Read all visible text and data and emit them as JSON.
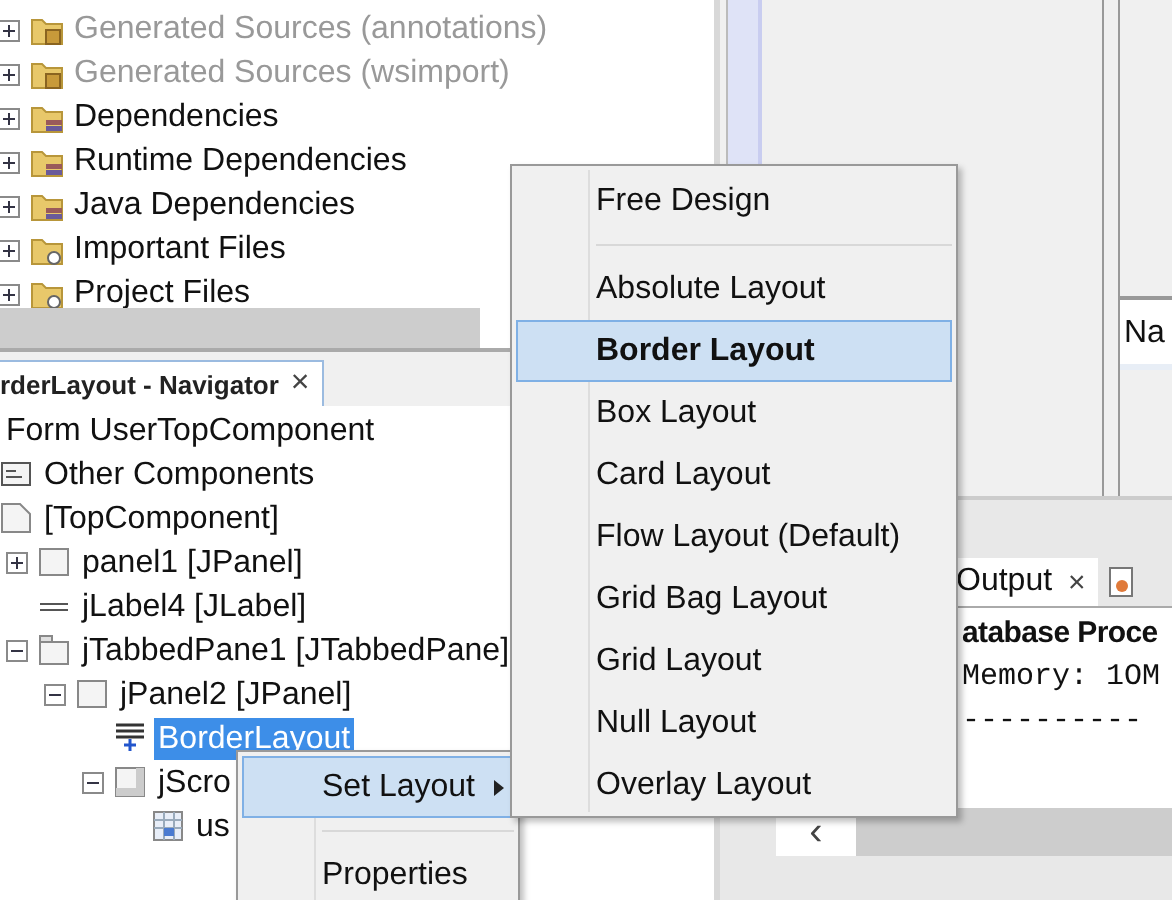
{
  "project_tree": {
    "items": [
      {
        "label": "Generated Sources (annotations)",
        "kind": "generated",
        "expanded": false,
        "greyed": true
      },
      {
        "label": "Generated Sources (wsimport)",
        "kind": "generated",
        "expanded": false,
        "greyed": true
      },
      {
        "label": "Dependencies",
        "kind": "library",
        "expanded": false,
        "greyed": false
      },
      {
        "label": "Runtime Dependencies",
        "kind": "library",
        "expanded": false,
        "greyed": false
      },
      {
        "label": "Java Dependencies",
        "kind": "library",
        "expanded": false,
        "greyed": false
      },
      {
        "label": "Important Files",
        "kind": "files",
        "expanded": false,
        "greyed": false
      },
      {
        "label": "Project Files",
        "kind": "files",
        "expanded": false,
        "greyed": false
      }
    ]
  },
  "navigator": {
    "tab": {
      "title": "rderLayout - Navigator",
      "close": "×"
    },
    "tree": [
      {
        "label": "Form UserTopComponent",
        "selected": false,
        "children": [
          {
            "label": "Other Components",
            "kind": "other",
            "selected": false
          },
          {
            "label": "[TopComponent]",
            "kind": "top",
            "selected": false,
            "children": [
              {
                "label": "panel1 [JPanel]",
                "kind": "panel",
                "expanded": false,
                "selected": false
              },
              {
                "label": "jLabel4 [JLabel]",
                "kind": "label",
                "selected": false
              },
              {
                "label": "jTabbedPane1 [JTabbedPane]",
                "kind": "tabbed",
                "expanded": true,
                "selected": false,
                "children": [
                  {
                    "label": "jPanel2 [JPanel]",
                    "kind": "panel",
                    "expanded": true,
                    "selected": false,
                    "children": [
                      {
                        "label": "BorderLayout",
                        "kind": "layout",
                        "selected": true
                      },
                      {
                        "label": "jScro",
                        "kind": "scroll",
                        "expanded": true,
                        "selected": false,
                        "children": [
                          {
                            "label": "us",
                            "kind": "table",
                            "selected": false
                          }
                        ]
                      }
                    ]
                  }
                ]
              }
            ]
          }
        ]
      }
    ]
  },
  "properties_table": {
    "column_1": "Na"
  },
  "output": {
    "tab": {
      "title": "Output",
      "close": "×"
    },
    "lines": [
      {
        "text": "atabase Proce",
        "kind": "heading"
      },
      {
        "text": "Memory: 1OM",
        "kind": "mono"
      },
      {
        "text": "----------",
        "kind": "mono"
      }
    ],
    "scroll_left": "‹"
  },
  "context_menu": {
    "items": [
      {
        "label": "Set Layout",
        "kind": "submenu",
        "selected": true
      },
      {
        "kind": "separator"
      },
      {
        "label": "Properties",
        "kind": "item",
        "selected": false
      }
    ]
  },
  "layout_submenu": {
    "items": [
      {
        "label": "Free Design",
        "kind": "item",
        "selected": false,
        "current": false
      },
      {
        "kind": "separator"
      },
      {
        "label": "Absolute Layout",
        "kind": "item",
        "selected": false,
        "current": false
      },
      {
        "label": "Border Layout",
        "kind": "item",
        "selected": true,
        "current": true
      },
      {
        "label": "Box Layout",
        "kind": "item",
        "selected": false,
        "current": false
      },
      {
        "label": "Card Layout",
        "kind": "item",
        "selected": false,
        "current": false
      },
      {
        "label": "Flow Layout (Default)",
        "kind": "item",
        "selected": false,
        "current": false
      },
      {
        "label": "Grid Bag Layout",
        "kind": "item",
        "selected": false,
        "current": false
      },
      {
        "label": "Grid Layout",
        "kind": "item",
        "selected": false,
        "current": false
      },
      {
        "label": "Null Layout",
        "kind": "item",
        "selected": false,
        "current": false
      },
      {
        "label": "Overlay Layout",
        "kind": "item",
        "selected": false,
        "current": false
      }
    ]
  }
}
